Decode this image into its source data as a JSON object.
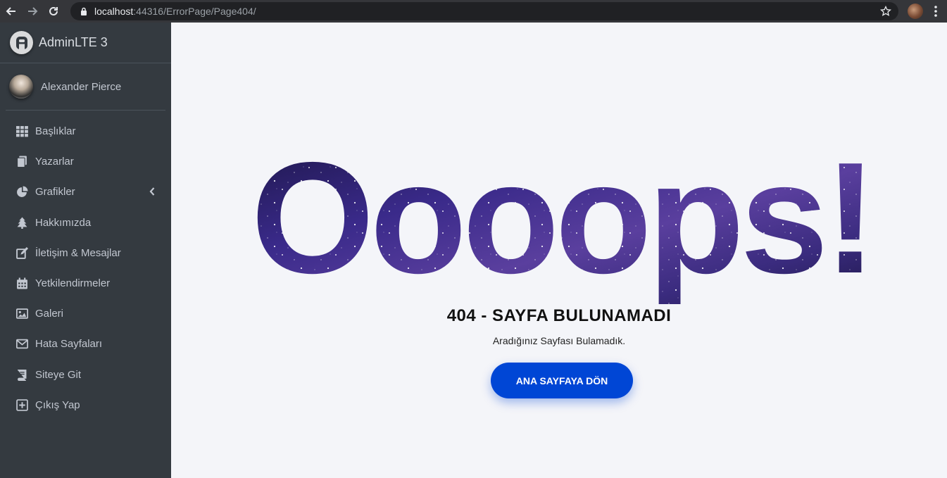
{
  "browser": {
    "url_host": "localhost",
    "url_rest": ":44316/ErrorPage/Page404/"
  },
  "sidebar": {
    "brand": "AdminLTE 3",
    "user_name": "Alexander Pierce",
    "items": [
      {
        "label": "Başlıklar",
        "icon": "th-grid-icon"
      },
      {
        "label": "Yazarlar",
        "icon": "copy-icon"
      },
      {
        "label": "Grafikler",
        "icon": "pie-chart-icon"
      },
      {
        "label": "Hakkımızda",
        "icon": "tree-icon"
      },
      {
        "label": "İletişim & Mesajlar",
        "icon": "edit-icon"
      },
      {
        "label": "Yetkilendirmeler",
        "icon": "calendar-icon"
      },
      {
        "label": "Galeri",
        "icon": "image-icon"
      },
      {
        "label": "Hata Sayfaları",
        "icon": "envelope-icon"
      },
      {
        "label": "Siteye Git",
        "icon": "book-icon"
      },
      {
        "label": "Çıkış Yap",
        "icon": "plus-square-icon"
      }
    ]
  },
  "main": {
    "hero": "Oooops!",
    "title": "404 - SAYFA BULUNAMADI",
    "subtitle": "Aradığınız Sayfası Bulamadık.",
    "button": "ANA SAYFAYA DÖN"
  },
  "colors": {
    "sidebar_bg": "#343a40",
    "button_bg": "#0046d5",
    "page_bg": "#f4f5f9"
  }
}
